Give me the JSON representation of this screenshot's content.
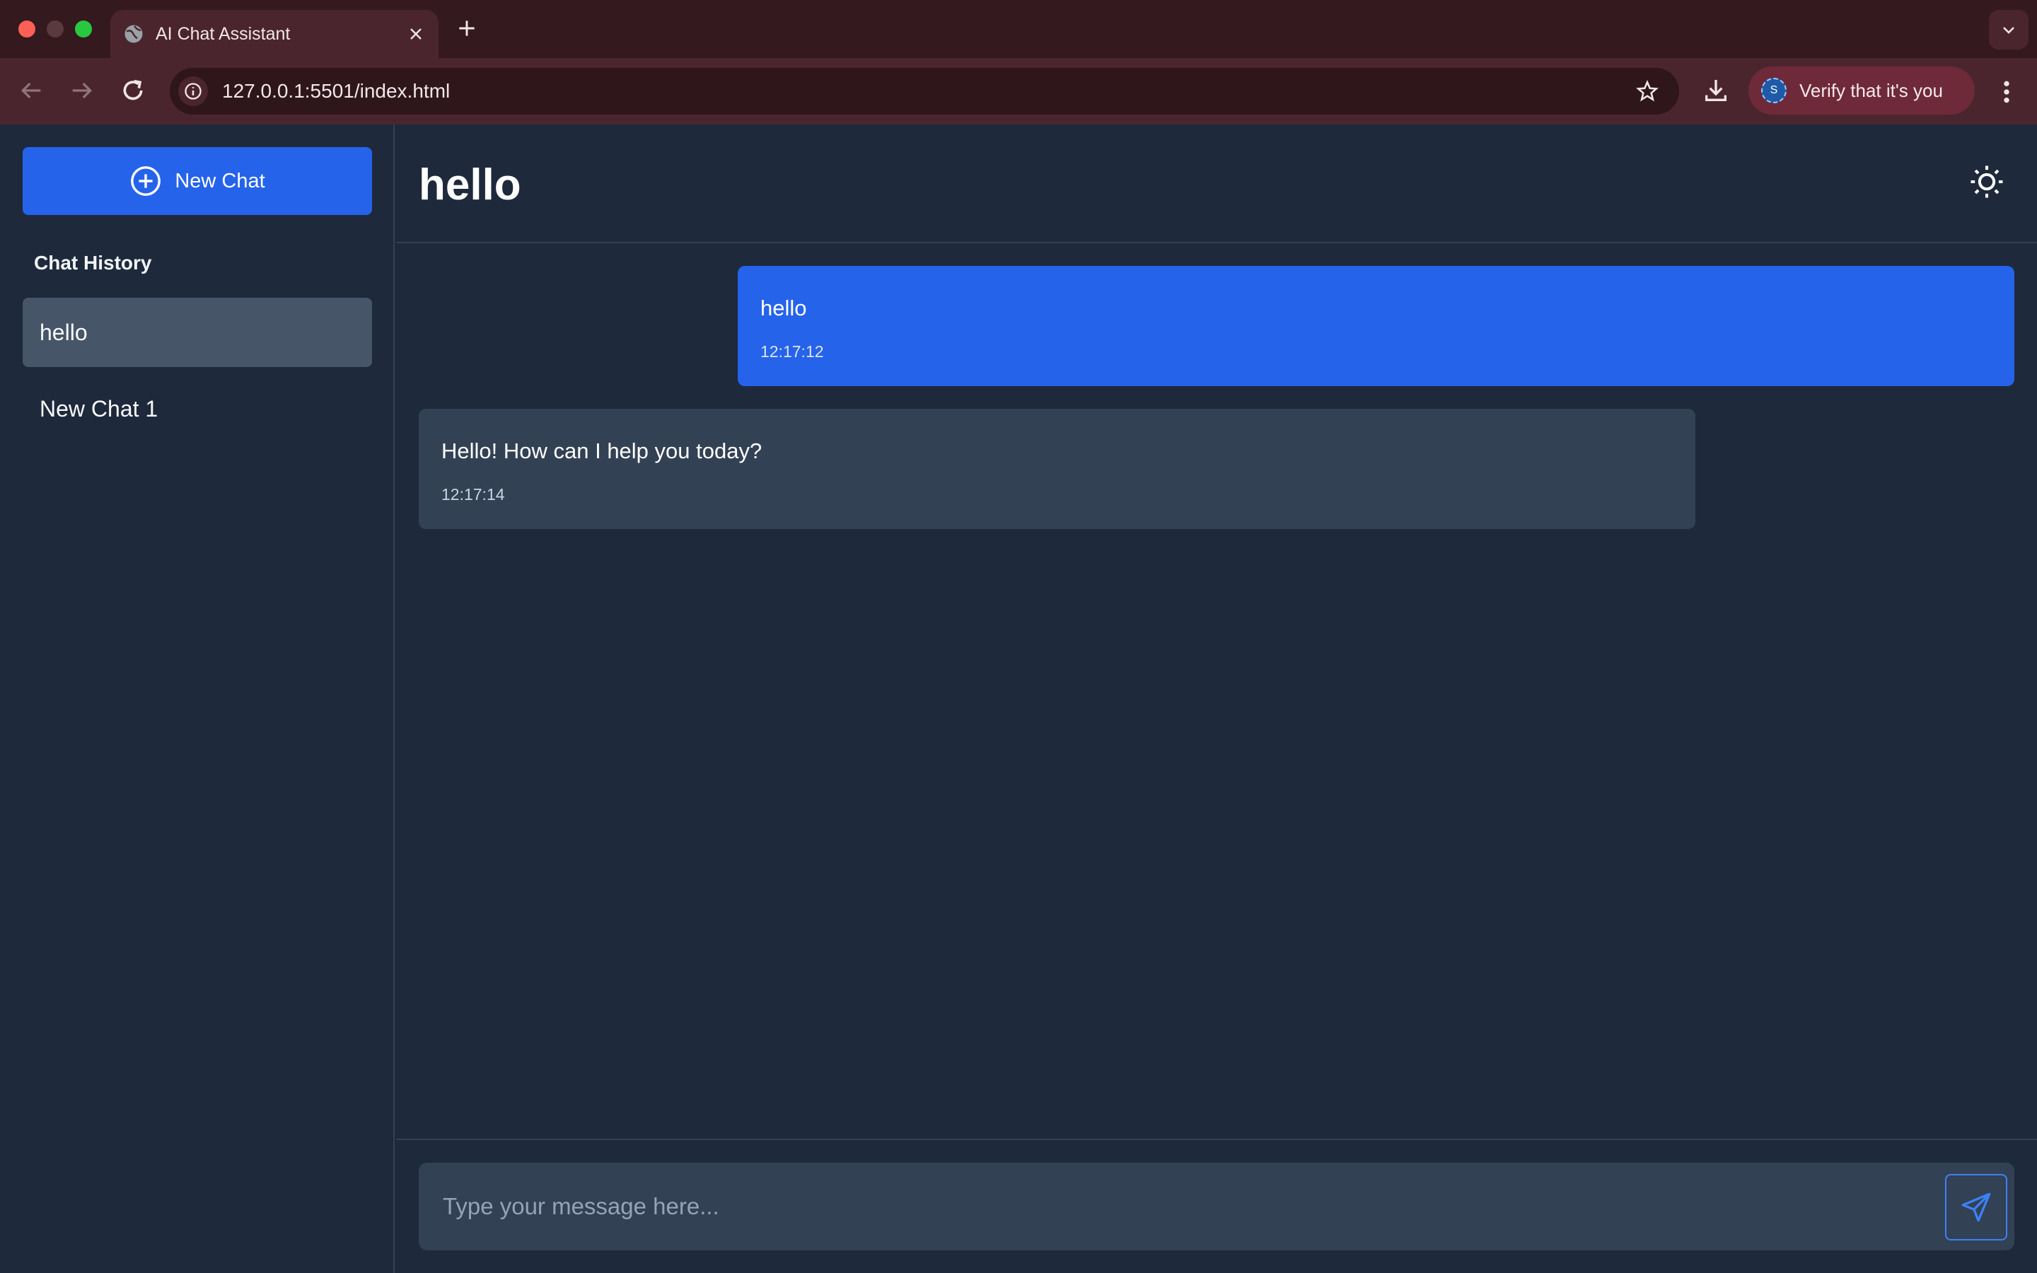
{
  "browser": {
    "tab_title": "AI Chat Assistant",
    "url": "127.0.0.1:5501/index.html",
    "profile_label": "Verify that it's you",
    "profile_initial": "S"
  },
  "sidebar": {
    "new_chat_label": "New Chat",
    "history_title": "Chat History",
    "items": [
      {
        "label": "hello",
        "active": true
      },
      {
        "label": "New Chat 1",
        "active": false
      }
    ]
  },
  "main": {
    "title": "hello",
    "messages": [
      {
        "role": "user",
        "text": "hello",
        "time": "12:17:12"
      },
      {
        "role": "assistant",
        "text": "Hello! How can I help you today?",
        "time": "12:17:14"
      }
    ],
    "input_placeholder": "Type your message here..."
  },
  "colors": {
    "accent": "#2563eb",
    "background": "#1e293b",
    "bubble_assistant": "#334155"
  }
}
